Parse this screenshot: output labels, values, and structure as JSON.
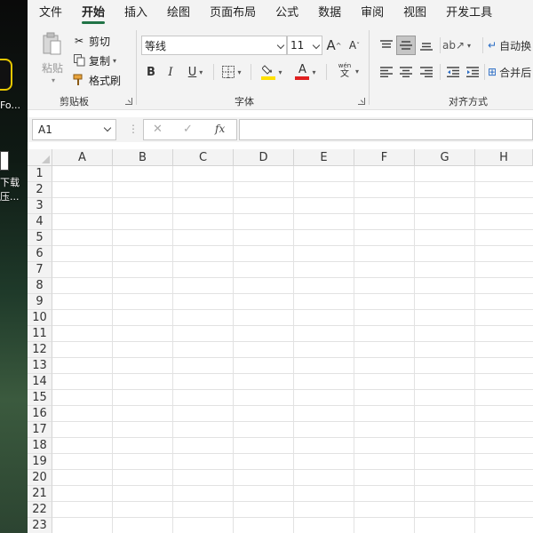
{
  "desktop": {
    "icon1_label": "Fo...",
    "icon2_label_line1": "下载",
    "icon2_label_line2": "压..."
  },
  "menu": {
    "tabs": [
      "文件",
      "开始",
      "插入",
      "绘图",
      "页面布局",
      "公式",
      "数据",
      "审阅",
      "视图",
      "开发工具"
    ],
    "active": "开始"
  },
  "ribbon": {
    "clipboard": {
      "paste": "粘贴",
      "cut": "剪切",
      "copy": "复制",
      "format_painter": "格式刷",
      "group_label": "剪贴板"
    },
    "font": {
      "font_name": "等线",
      "font_size": "11",
      "grow": "A",
      "shrink": "A",
      "bold": "B",
      "italic": "I",
      "underline": "U",
      "font_color_letter": "A",
      "wen": "wén",
      "wen_char": "文",
      "group_label": "字体",
      "fill_color": "#ffe000",
      "font_color": "#e02020"
    },
    "alignment": {
      "wrap_text": "自动换",
      "merge": "合并后",
      "group_label": "对齐方式"
    }
  },
  "formula_bar": {
    "namebox": "A1",
    "cancel": "✕",
    "enter": "✓",
    "fx": "fx",
    "content": ""
  },
  "sheet": {
    "columns": [
      "A",
      "B",
      "C",
      "D",
      "E",
      "F",
      "G",
      "H"
    ],
    "rows": [
      "1",
      "2",
      "3",
      "4",
      "5",
      "6",
      "7",
      "8",
      "9",
      "10",
      "11",
      "12",
      "13",
      "14",
      "15",
      "16",
      "17",
      "18",
      "19",
      "20",
      "21",
      "22",
      "23"
    ]
  }
}
